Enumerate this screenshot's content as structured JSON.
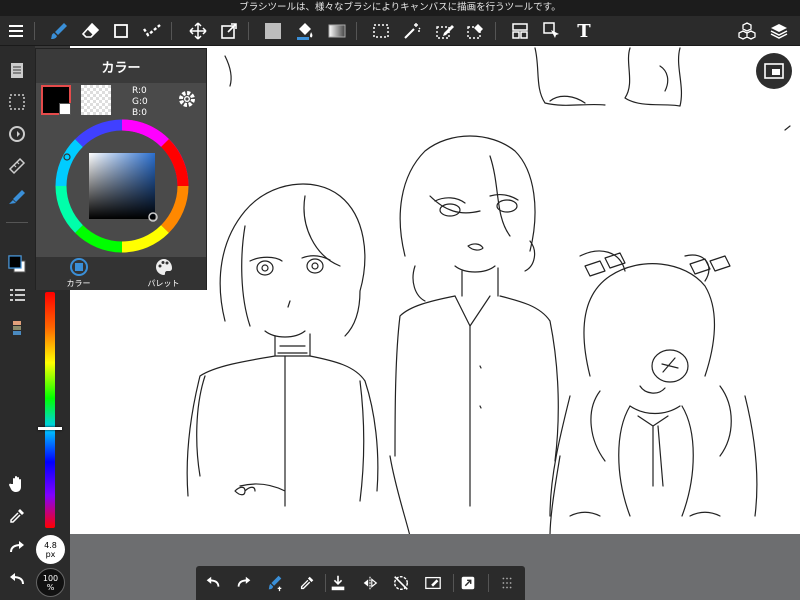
{
  "hint": {
    "text": "ブラシツールは、様々なブラシによりキャンバスに描画を行うツールです。"
  },
  "toolbar": {
    "menu": "menu-icon",
    "tools": [
      "brush-icon",
      "eraser-icon",
      "shape-icon",
      "dots-icon",
      "move-icon",
      "transform-icon",
      "fill-color-icon",
      "bucket-icon",
      "gradient-icon",
      "select-rect-icon",
      "magic-wand-icon",
      "select-pen-icon",
      "select-eraser-icon",
      "frame-icon",
      "operation-icon",
      "text-icon"
    ],
    "text_tool_label": "T",
    "right": [
      "materials-icon",
      "layers-icon"
    ]
  },
  "color_panel": {
    "title": "カラー",
    "rgb": {
      "r": "R:0",
      "g": "G:0",
      "b": "B:0"
    },
    "main_color": "#000000",
    "tabs": [
      {
        "label": "カラー"
      },
      {
        "label": "パレット"
      }
    ]
  },
  "left_toolbar": {
    "tools": [
      "pages-icon",
      "select-icon",
      "rotate-icon",
      "ruler-icon",
      "fill-icon",
      "color-icon",
      "brush-list-icon",
      "layer-list-icon",
      "hand-icon",
      "eyedropper-icon",
      "redo-icon",
      "undo-icon"
    ],
    "size": {
      "value": "4.8",
      "unit": "px"
    },
    "opacity": {
      "value": "100",
      "unit": "%"
    },
    "slider_level": 0.57
  },
  "bottom_toolbar": {
    "tools": [
      "undo-icon",
      "redo-icon",
      "brush-settings-icon",
      "eyedropper-icon",
      "layer-import-icon",
      "flip-icon",
      "snap-icon",
      "eraser-sub-icon",
      "screenshot-icon",
      "grid-icon"
    ]
  },
  "accent": "#3a8fd8"
}
